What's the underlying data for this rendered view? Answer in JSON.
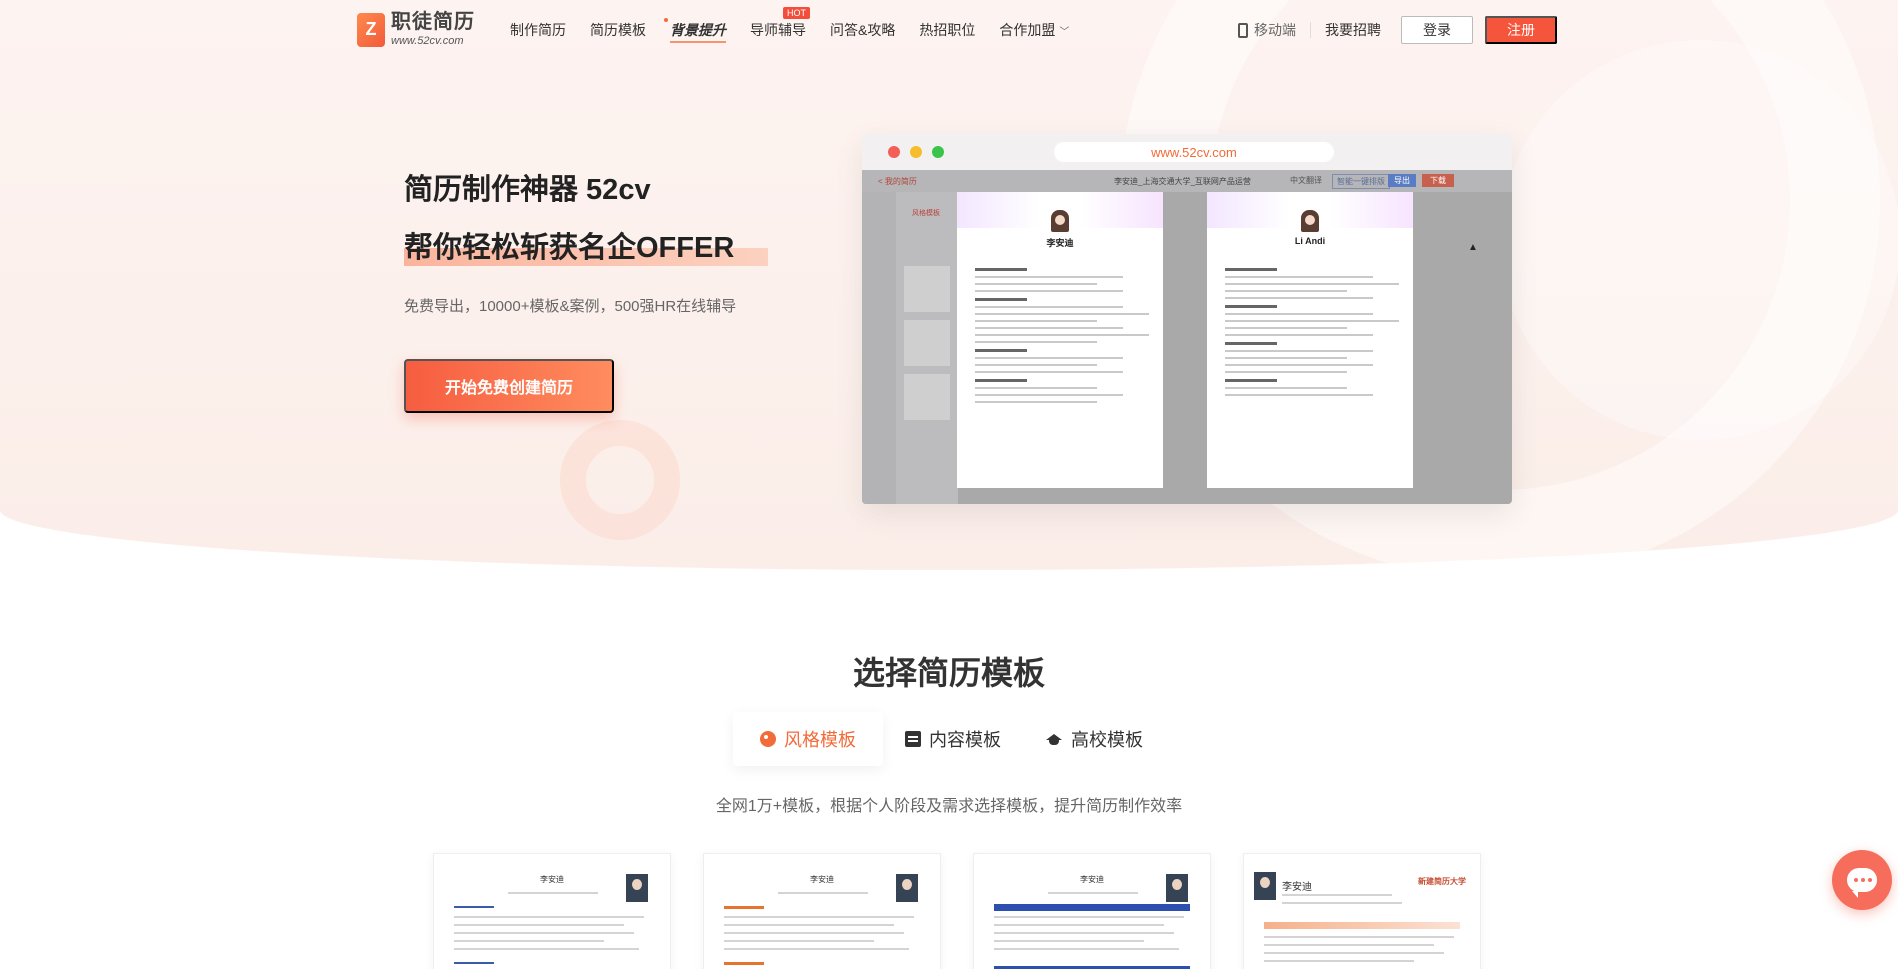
{
  "header": {
    "logo": {
      "name": "职徒简历",
      "url": "www.52cv.com",
      "mark": "Z"
    },
    "nav": [
      {
        "label": "制作简历",
        "special": false
      },
      {
        "label": "简历模板",
        "special": false
      },
      {
        "label": "背景提升",
        "special": true
      },
      {
        "label": "导师辅导",
        "special": false,
        "badge": "HOT"
      },
      {
        "label": "问答&攻略",
        "special": false
      },
      {
        "label": "热招职位",
        "special": false
      },
      {
        "label": "合作加盟",
        "special": false,
        "dropdown": true
      }
    ],
    "mobile_label": "移动端",
    "hire_label": "我要招聘",
    "login_label": "登录",
    "register_label": "注册",
    "accent_color": "#f5553b"
  },
  "hero": {
    "title_line1": "简历制作神器 52cv",
    "title_line2": "帮你轻松斩获名企OFFER",
    "subtitle": "免费导出，10000+模板&案例，500强HR在线辅导",
    "cta_label": "开始免费创建简历"
  },
  "mockup": {
    "url": "www.52cv.com",
    "back_label": "< 我的简历",
    "doc_title": "李安迪_上海交通大学_互联网产品运营",
    "toolbar": [
      "中文翻译",
      "智能一键排版",
      "导出",
      "下载"
    ],
    "panel_tab": "风格模板",
    "resume_names": [
      "李安迪",
      "Li Andi"
    ]
  },
  "templates": {
    "title": "选择简历模板",
    "tabs": [
      {
        "label": "风格模板",
        "icon": "palette-icon",
        "active": true
      },
      {
        "label": "内容模板",
        "icon": "document-icon",
        "active": false
      },
      {
        "label": "高校模板",
        "icon": "graduation-cap-icon",
        "active": false
      }
    ],
    "subtitle": "全网1万+模板，根据个人阶段及需求选择模板，提升简历制作效率",
    "cards": [
      {
        "name": "李安迪",
        "accent": "#3a5ca8"
      },
      {
        "name": "李安迪",
        "accent": "#e8732f"
      },
      {
        "name": "李安迪",
        "accent": "#2c4fb0"
      },
      {
        "name": "李安迪",
        "accent": "#e8732f",
        "school": "新建简历大学"
      }
    ]
  },
  "chat": {
    "icon": "chat-bubble-icon",
    "color": "#f66d5c"
  }
}
